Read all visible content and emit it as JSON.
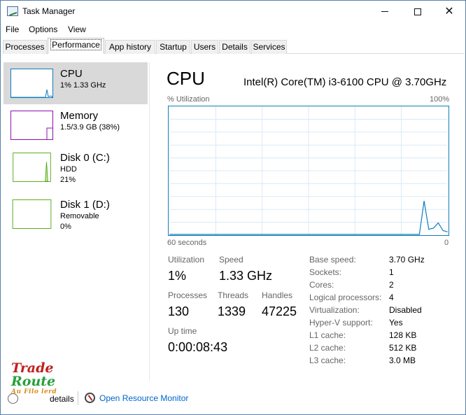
{
  "window": {
    "title": "Task Manager",
    "icon": "task-manager-icon"
  },
  "menu": {
    "file": "File",
    "options": "Options",
    "view": "View"
  },
  "tabs": [
    {
      "label": "Processes"
    },
    {
      "label": "Performance",
      "active": true
    },
    {
      "label": "App history"
    },
    {
      "label": "Startup"
    },
    {
      "label": "Users"
    },
    {
      "label": "Details"
    },
    {
      "label": "Services"
    }
  ],
  "sidebar": {
    "items": [
      {
        "title": "CPU",
        "sub1": "1%  1.33 GHz",
        "sub2": "",
        "color": "#117dbb"
      },
      {
        "title": "Memory",
        "sub1": "1.5/3.9 GB (38%)",
        "sub2": "",
        "color": "#8b12ae"
      },
      {
        "title": "Disk 0 (C:)",
        "sub1": "HDD",
        "sub2": "21%",
        "color": "#4da60c"
      },
      {
        "title": "Disk 1 (D:)",
        "sub1": "Removable",
        "sub2": "0%",
        "color": "#4da60c"
      }
    ]
  },
  "cpu": {
    "header": "CPU",
    "model": "Intel(R) Core(TM) i3-6100 CPU @ 3.70GHz",
    "util_label": "% Utilization",
    "pct_max": "100%",
    "secs_label": "60 seconds",
    "zero_label": "0",
    "graph_color": "#117dbb",
    "graph_points": [
      0,
      0,
      0,
      0,
      0,
      0,
      0,
      0,
      0,
      0,
      0,
      0,
      0,
      0,
      0,
      0,
      0,
      0,
      0,
      0,
      0,
      0,
      0,
      0,
      0,
      0,
      0,
      0,
      0,
      0,
      0,
      0,
      0,
      0,
      0,
      0,
      0,
      0,
      0,
      0,
      0,
      0,
      0,
      0,
      0,
      0,
      0,
      0,
      0,
      0,
      0,
      0,
      0,
      0,
      26,
      4,
      5,
      9,
      3,
      2
    ]
  },
  "stats": {
    "utilization_label": "Utilization",
    "utilization_value": "1%",
    "speed_label": "Speed",
    "speed_value": "1.33 GHz",
    "processes_label": "Processes",
    "processes_value": "130",
    "threads_label": "Threads",
    "threads_value": "1339",
    "handles_label": "Handles",
    "handles_value": "47225",
    "uptime_label": "Up time",
    "uptime_value": "0:00:08:43"
  },
  "info": [
    {
      "label": "Base speed:",
      "value": "3.70 GHz"
    },
    {
      "label": "Sockets:",
      "value": "1"
    },
    {
      "label": "Cores:",
      "value": "2"
    },
    {
      "label": "Logical processors:",
      "value": "4"
    },
    {
      "label": "Virtualization:",
      "value": "Disabled"
    },
    {
      "label": "Hyper-V support:",
      "value": "Yes"
    },
    {
      "label": "L1 cache:",
      "value": "128 KB"
    },
    {
      "label": "L2 cache:",
      "value": "512 KB"
    },
    {
      "label": "L3 cache:",
      "value": "3.0 MB"
    }
  ],
  "footer": {
    "fewer_details": "details",
    "open_resource_monitor": "Open Resource Monitor"
  },
  "logo": {
    "line1": "Trade",
    "line2": "Route",
    "line3": "Au Filo lerd"
  }
}
